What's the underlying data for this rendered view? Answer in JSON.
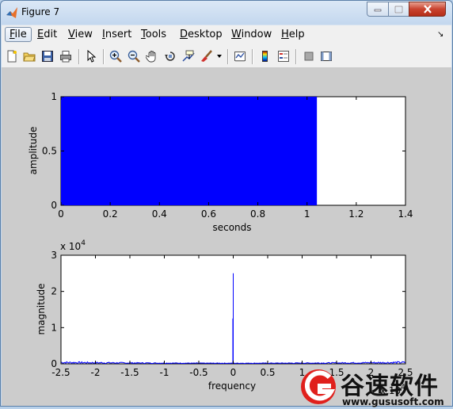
{
  "window": {
    "title": "Figure 7"
  },
  "menu": [
    {
      "key": "F",
      "rest": "ile",
      "label": "File"
    },
    {
      "key": "E",
      "rest": "dit",
      "label": "Edit"
    },
    {
      "key": "V",
      "rest": "iew",
      "label": "View"
    },
    {
      "key": "I",
      "rest": "nsert",
      "label": "Insert"
    },
    {
      "key": "T",
      "rest": "ools",
      "label": "Tools"
    },
    {
      "key": "D",
      "rest": "esktop",
      "label": "Desktop"
    },
    {
      "key": "W",
      "rest": "indow",
      "label": "Window"
    },
    {
      "key": "H",
      "rest": "elp",
      "label": "Help"
    }
  ],
  "toolbar": {
    "icons": [
      "new-figure-icon",
      "open-file-icon",
      "save-icon",
      "print-icon",
      "edit-plot-arrow-icon",
      "zoom-in-icon",
      "zoom-out-icon",
      "pan-hand-icon",
      "rotate-3d-icon",
      "data-cursor-icon",
      "brush-icon",
      "brush-dropdown-icon",
      "link-plot-icon",
      "colorbar-icon",
      "legend-icon",
      "hide-plot-tools-icon",
      "show-plot-tools-icon"
    ]
  },
  "colors": {
    "signal": "#0000ff",
    "axes_bg": "#ffffff",
    "figure_bg": "#cccccc"
  },
  "chart_data": [
    {
      "type": "area",
      "xlabel": "seconds",
      "ylabel": "amplitude",
      "xlim": [
        0,
        1.4
      ],
      "ylim": [
        0,
        1
      ],
      "xticks": [
        "0",
        "0.2",
        "0.4",
        "0.6",
        "0.8",
        "1",
        "1.2",
        "1.4"
      ],
      "yticks": [
        "0",
        "0.5",
        "1"
      ],
      "series": [
        {
          "x_start": 0,
          "x_end": 1.04,
          "y_min": 0,
          "y_max": 1
        }
      ]
    },
    {
      "type": "line",
      "xlabel": "frequency",
      "ylabel": "magnitude",
      "xlim": [
        -25000,
        25000
      ],
      "ylim": [
        0,
        30000
      ],
      "x_exponent_label": "x 10",
      "x_exponent": "4",
      "y_exponent_label": "x 10",
      "y_exponent": "4",
      "xticks": [
        "-2.5",
        "-2",
        "-1.5",
        "-1",
        "-0.5",
        "0",
        "0.5",
        "1",
        "1.5",
        "2",
        "2.5"
      ],
      "yticks": [
        "0",
        "1",
        "2",
        "3"
      ],
      "peaks": [
        {
          "x": 0,
          "y": 25000
        },
        {
          "x": -60,
          "y": 12500
        }
      ],
      "noise_floor": 300
    }
  ],
  "watermark": {
    "name": "谷速软件",
    "url": "www.gususoft.com"
  }
}
